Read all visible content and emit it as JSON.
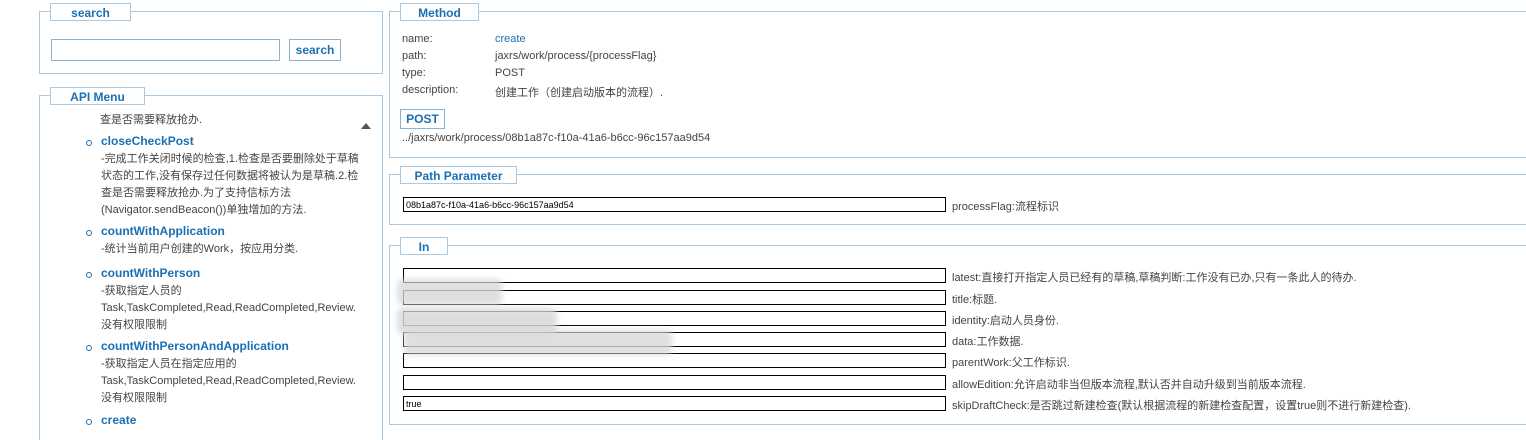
{
  "search": {
    "legend": "search",
    "input_value": "",
    "button_label": "search"
  },
  "api_menu": {
    "legend": "API Menu",
    "truncated_line": "查是否需要释放抢办.",
    "items": [
      {
        "name": "closeCheckPost",
        "desc": "-完成工作关闭时候的检查,1.检查是否要删除处于草稿状态的工作,没有保存过任何数据将被认为是草稿.2.检查是否需要释放抢办.为了支持信标方法(Navigator.sendBeacon())单独增加的方法."
      },
      {
        "name": "countWithApplication",
        "desc": "-统计当前用户创建的Work，按应用分类."
      },
      {
        "name": "countWithPerson",
        "desc": "-获取指定人员的Task,TaskCompleted,Read,ReadCompleted,Review.没有权限限制"
      },
      {
        "name": "countWithPersonAndApplication",
        "desc": "-获取指定人员在指定应用的Task,TaskCompleted,Read,ReadCompleted,Review.没有权限限制"
      },
      {
        "name": "create",
        "desc": ""
      }
    ]
  },
  "method": {
    "legend": "Method",
    "name_label": "name:",
    "name_value": "create",
    "path_label": "path:",
    "path_value": "jaxrs/work/process/{processFlag}",
    "type_label": "type:",
    "type_value": "POST",
    "description_label": "description:",
    "description_value": "创建工作（创建启动版本的流程）.",
    "post_button": "POST",
    "url": "../jaxrs/work/process/08b1a87c-f10a-41a6-b6cc-96c157aa9d54"
  },
  "path_parameter": {
    "legend": "Path Parameter",
    "params": [
      {
        "value": "08b1a87c-f10a-41a6-b6cc-96c157aa9d54",
        "label": "processFlag:流程标识"
      }
    ]
  },
  "in": {
    "legend": "In",
    "params": [
      {
        "value": "",
        "label": "latest:直接打开指定人员已经有的草稿,草稿判断:工作没有已办,只有一条此人的待办."
      },
      {
        "value": "",
        "label": "title:标题."
      },
      {
        "value": "",
        "label": "identity:启动人员身份."
      },
      {
        "value": "",
        "label": "data:工作数据."
      },
      {
        "value": "",
        "label": "parentWork:父工作标识."
      },
      {
        "value": "",
        "label": "allowEdition:允许启动非当但版本流程,默认否并自动升级到当前版本流程."
      },
      {
        "value": "true",
        "label": "skipDraftCheck:是否跳过新建检查(默认根据流程的新建检查配置，设置true则不进行新建检查)."
      }
    ]
  }
}
